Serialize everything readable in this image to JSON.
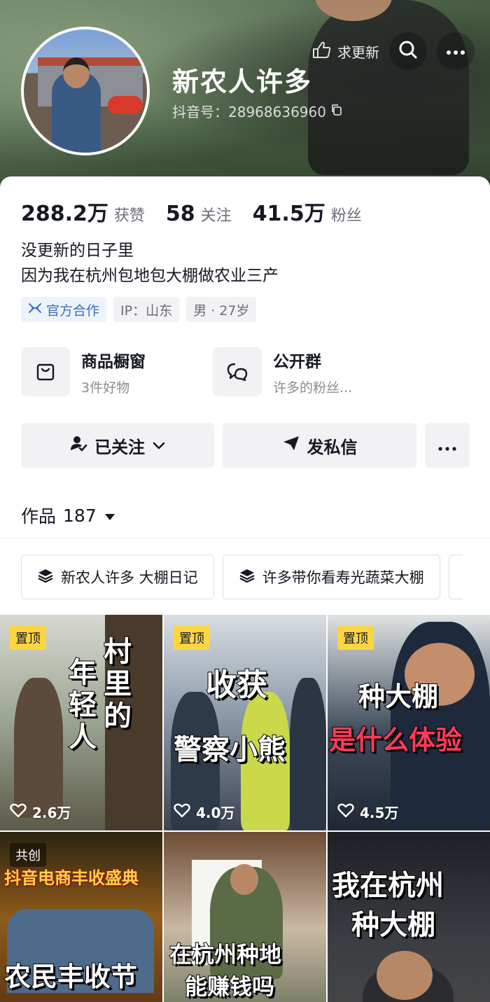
{
  "header": {
    "refresh_label": "求更新",
    "name": "新农人许多",
    "douyin_id": "抖音号：28968636960"
  },
  "stats": [
    {
      "value": "288.2万",
      "label": "获赞"
    },
    {
      "value": "58",
      "label": "关注"
    },
    {
      "value": "41.5万",
      "label": "粉丝"
    }
  ],
  "bio": {
    "line1": "没更新的日子里",
    "line2": "因为我在杭州包地包大棚做农业三产"
  },
  "tags": {
    "official": "官方合作",
    "ip": "IP：山东",
    "gender_age": "男 · 27岁"
  },
  "features": {
    "shop_title": "商品橱窗",
    "shop_sub": "3件好物",
    "group_title": "公开群",
    "group_sub": "许多的粉丝..."
  },
  "actions": {
    "follow": "已关注",
    "message": "发私信"
  },
  "works": {
    "label": "作品",
    "count": "187"
  },
  "collections": [
    {
      "label": "新农人许多 大棚日记"
    },
    {
      "label": "许多带你看寿光蔬菜大棚"
    }
  ],
  "videos": [
    {
      "badge": "置顶",
      "title_a": "村里的",
      "title_b": "年轻人",
      "likes": "2.6万"
    },
    {
      "badge": "置顶",
      "title_a": "收获",
      "title_b": "警察小熊",
      "likes": "4.0万"
    },
    {
      "badge": "置顶",
      "title_a": "种大棚",
      "title_b": "是什么体验",
      "likes": "4.5万"
    },
    {
      "badge": "共创",
      "title_a": "抖音电商丰收盛典",
      "title_b": "农民丰收节",
      "likes": ""
    },
    {
      "badge": "",
      "title_a": "在杭州种地",
      "title_b": "能赚钱吗",
      "likes": ""
    },
    {
      "badge": "",
      "title_a": "我在杭州",
      "title_b": "种大棚",
      "likes": ""
    }
  ]
}
